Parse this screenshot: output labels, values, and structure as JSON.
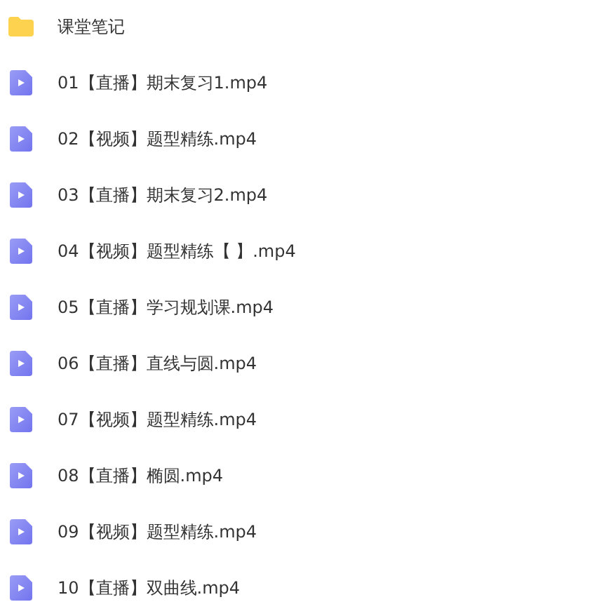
{
  "files": [
    {
      "kind": "folder",
      "name": "课堂笔记"
    },
    {
      "kind": "video",
      "name": "01【直播】期末复习1.mp4"
    },
    {
      "kind": "video",
      "name": "02【视频】题型精练.mp4"
    },
    {
      "kind": "video",
      "name": "03【直播】期末复习2.mp4"
    },
    {
      "kind": "video",
      "name": "04【视频】题型精练【 】.mp4"
    },
    {
      "kind": "video",
      "name": "05【直播】学习规划课.mp4"
    },
    {
      "kind": "video",
      "name": "06【直播】直线与圆.mp4"
    },
    {
      "kind": "video",
      "name": "07【视频】题型精练.mp4"
    },
    {
      "kind": "video",
      "name": "08【直播】椭圆.mp4"
    },
    {
      "kind": "video",
      "name": "09【视频】题型精练.mp4"
    },
    {
      "kind": "video",
      "name": "10【直播】双曲线.mp4"
    }
  ]
}
